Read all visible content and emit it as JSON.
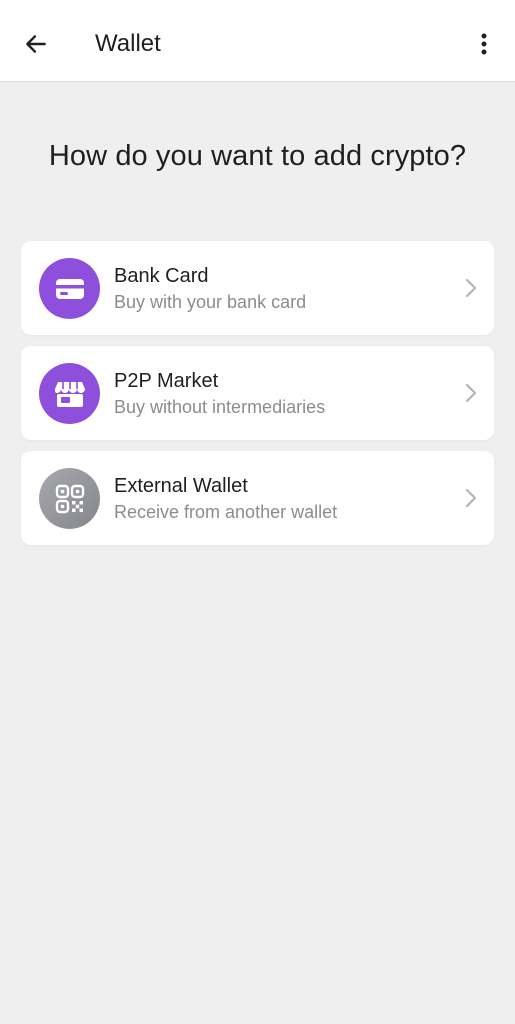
{
  "app_bar": {
    "title": "Wallet",
    "back_icon": "arrow-left-icon",
    "more_icon": "more-vertical-icon"
  },
  "headline": "How do you want to add crypto?",
  "options": [
    {
      "title": "Bank Card",
      "subtitle": "Buy with your bank card",
      "icon": "credit-card-icon",
      "icon_bg": "#8d4fdc"
    },
    {
      "title": "P2P Market",
      "subtitle": "Buy without intermediaries",
      "icon": "storefront-icon",
      "icon_bg": "#8d4fdc"
    },
    {
      "title": "External Wallet",
      "subtitle": "Receive from another wallet",
      "icon": "qr-code-icon",
      "icon_bg": "#96979c"
    }
  ],
  "colors": {
    "accent": "#8d4fdc",
    "background": "#efefef",
    "card": "#ffffff",
    "secondary_text": "#8c8c8c"
  }
}
